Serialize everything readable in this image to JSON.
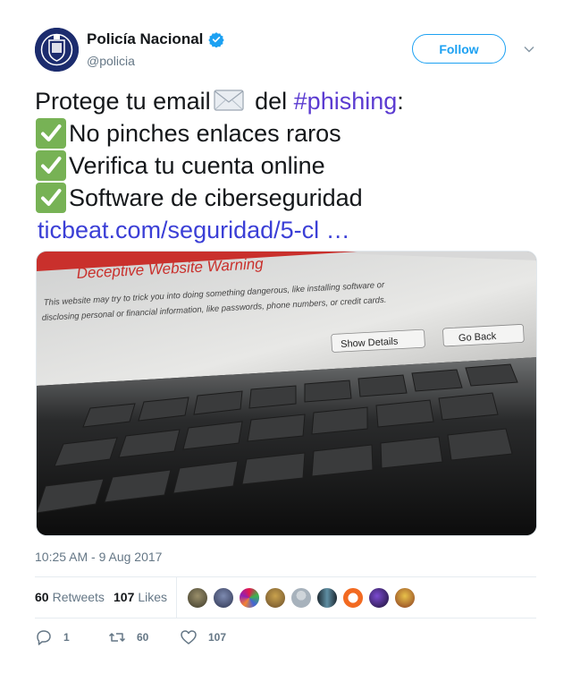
{
  "author": {
    "display_name": "Policía Nacional",
    "handle": "@policia",
    "verified": true
  },
  "follow_label": "Follow",
  "tweet": {
    "line1_a": "Protege tu email",
    "line1_b": " del ",
    "hashtag": "#phishing",
    "line1_c": ":",
    "items": [
      "No pinches enlaces raros",
      "Verifica tu cuenta online",
      "Software de ciberseguridad"
    ],
    "link": "ticbeat.com/seguridad/5-cl …"
  },
  "media": {
    "title": "Deceptive Website Warning",
    "body_line1": "This website may try to trick you into doing something dangerous, like installing software or",
    "body_line2": "disclosing personal or financial information, like passwords, phone numbers, or credit cards.",
    "button1": "Show Details",
    "button2": "Go Back"
  },
  "timestamp": "10:25 AM - 9 Aug 2017",
  "stats": {
    "retweets_count": "60",
    "retweets_label": "Retweets",
    "likes_count": "107",
    "likes_label": "Likes"
  },
  "actions": {
    "reply_count": "1",
    "retweet_count": "60",
    "like_count": "107"
  },
  "colors": {
    "accent": "#1da1f2",
    "link": "#3b3fd6",
    "muted": "#657786"
  }
}
